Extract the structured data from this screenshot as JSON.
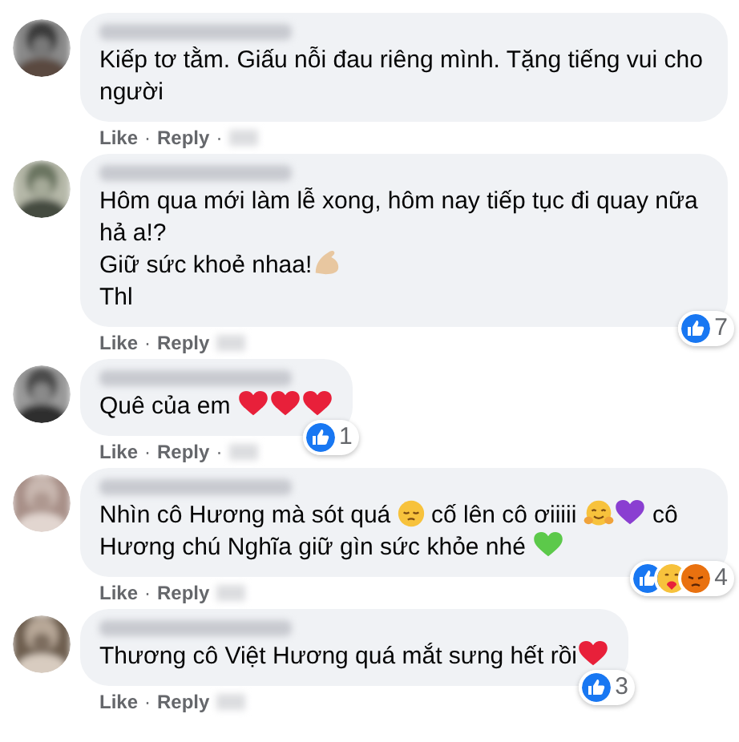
{
  "comments": [
    {
      "avatar": {
        "kind": "picture"
      },
      "body": [
        {
          "kind": "text",
          "text": "Kiếp tơ tằm. Giấu nỗi đau riêng mình. Tặng tiếng vui cho người"
        }
      ],
      "actions": [
        {
          "kind": "link",
          "text": "Like"
        },
        {
          "kind": "separator",
          "text": "·"
        },
        {
          "kind": "link",
          "text": "Reply"
        },
        {
          "kind": "separator",
          "text": "·"
        }
      ]
    },
    {
      "avatar": {
        "kind": "picture"
      },
      "body": [
        {
          "kind": "text",
          "text": "Hôm qua mới làm lễ xong, hôm nay tiếp tục đi quay nữa hả a!?"
        },
        {
          "kind": "break"
        },
        {
          "kind": "text",
          "text": "Giữ sức khoẻ nhaa!"
        },
        {
          "kind": "biceps"
        },
        {
          "kind": "break"
        },
        {
          "kind": "text",
          "text": "Thl"
        }
      ],
      "reactions": {
        "icons": [
          {
            "kind": "like"
          }
        ],
        "count": "7"
      },
      "actions": [
        {
          "kind": "link",
          "text": "Like"
        },
        {
          "kind": "separator",
          "text": "·"
        },
        {
          "kind": "link",
          "text": "Reply"
        }
      ]
    },
    {
      "avatar": {
        "kind": "picture"
      },
      "body": [
        {
          "kind": "text",
          "text": "Quê của em "
        },
        {
          "kind": "red-heart"
        },
        {
          "kind": "red-heart"
        },
        {
          "kind": "red-heart"
        }
      ],
      "reactions": {
        "icons": [
          {
            "kind": "like"
          }
        ],
        "count": "1"
      },
      "actions": [
        {
          "kind": "link",
          "text": "Like"
        },
        {
          "kind": "separator",
          "text": "·"
        },
        {
          "kind": "link",
          "text": "Reply"
        },
        {
          "kind": "separator",
          "text": "·"
        }
      ]
    },
    {
      "avatar": {
        "kind": "picture"
      },
      "body": [
        {
          "kind": "text",
          "text": "Nhìn cô Hương mà sót quá "
        },
        {
          "kind": "pensive-face"
        },
        {
          "kind": "text",
          "text": " cố lên cô ơiiiii "
        },
        {
          "kind": "hugging-face"
        },
        {
          "kind": "purple-heart"
        },
        {
          "kind": "text",
          "text": " cô Hương chú Nghĩa giữ gìn sức khỏe nhé "
        },
        {
          "kind": "green-heart"
        }
      ],
      "reactions": {
        "icons": [
          {
            "kind": "like"
          },
          {
            "kind": "care"
          },
          {
            "kind": "angry"
          }
        ],
        "count": "4"
      },
      "actions": [
        {
          "kind": "link",
          "text": "Like"
        },
        {
          "kind": "separator",
          "text": "·"
        },
        {
          "kind": "link",
          "text": "Reply"
        }
      ]
    },
    {
      "avatar": {
        "kind": "picture"
      },
      "body": [
        {
          "kind": "text",
          "text": "Thương cô Việt Hương quá mắt sưng hết rồi"
        },
        {
          "kind": "red-heart"
        }
      ],
      "reactions": {
        "icons": [
          {
            "kind": "like"
          }
        ],
        "count": "3"
      },
      "actions": [
        {
          "kind": "link",
          "text": "Like"
        },
        {
          "kind": "separator",
          "text": "·"
        },
        {
          "kind": "link",
          "text": "Reply"
        }
      ]
    }
  ]
}
